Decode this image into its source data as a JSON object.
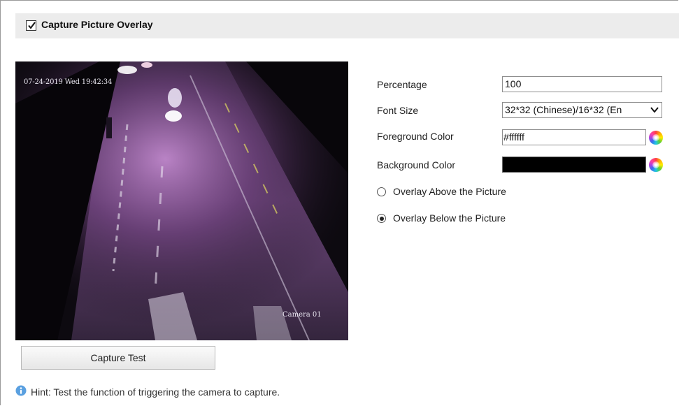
{
  "section": {
    "title": "Capture Picture Overlay",
    "enabled": true
  },
  "preview": {
    "timestamp": "07-24-2019 Wed 19:42:34",
    "camera_name": "Camera 01"
  },
  "form": {
    "percentage_label": "Percentage",
    "percentage_value": "100",
    "font_size_label": "Font Size",
    "font_size_value": "32*32 (Chinese)/16*32 (En",
    "foreground_label": "Foreground Color",
    "foreground_value": "#ffffff",
    "background_label": "Background Color",
    "background_value": "#000000",
    "overlay_above_label": "Overlay Above the Picture",
    "overlay_below_label": "Overlay Below the Picture",
    "overlay_selected": "below"
  },
  "capture_button_label": "Capture Test",
  "hint_text": "Hint: Test the function of triggering the camera to capture.",
  "icons": {
    "checkbox": "checkmark-icon",
    "dropdown": "chevron-down-icon",
    "palette": "color-wheel-icon",
    "hint": "info-icon"
  }
}
